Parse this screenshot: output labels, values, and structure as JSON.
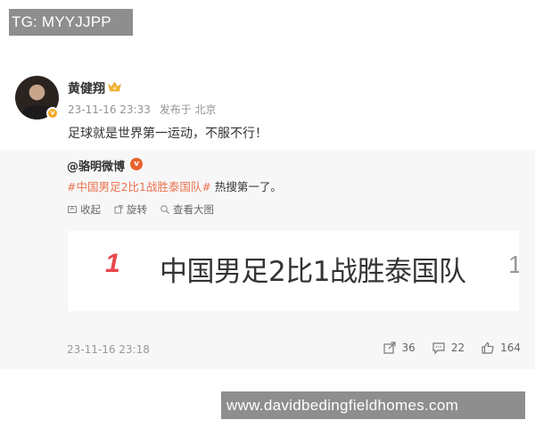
{
  "banner": {
    "text": "TG: MYYJJPP"
  },
  "post": {
    "author": "黄健翔",
    "avatar_badge": "v",
    "time": "23-11-16 23:33",
    "location": "发布于 北京",
    "content": "足球就是世界第一运动，不服不行！"
  },
  "repost": {
    "author": "@骆明微博",
    "verified_badge": "v",
    "hashtag": "#中国男足2比1战胜泰国队#",
    "text_tail": " 热搜第一了。",
    "actions": {
      "collect": "收起",
      "rotate": "旋转",
      "view_large": "查看大图"
    },
    "image": {
      "rank": "1",
      "title": "中国男足2比1战胜泰国队",
      "next_rank": "1"
    },
    "footer": {
      "time": "23-11-16 23:18",
      "shares": "36",
      "comments": "22",
      "likes": "164"
    }
  },
  "watermark": {
    "text": "www.davidbedingfieldhomes.com"
  },
  "colors": {
    "hashtag": "#eb7350",
    "rank": "#e8474c",
    "banner_bg": "#8e8e8e",
    "repost_bg": "#f7f7f7"
  }
}
